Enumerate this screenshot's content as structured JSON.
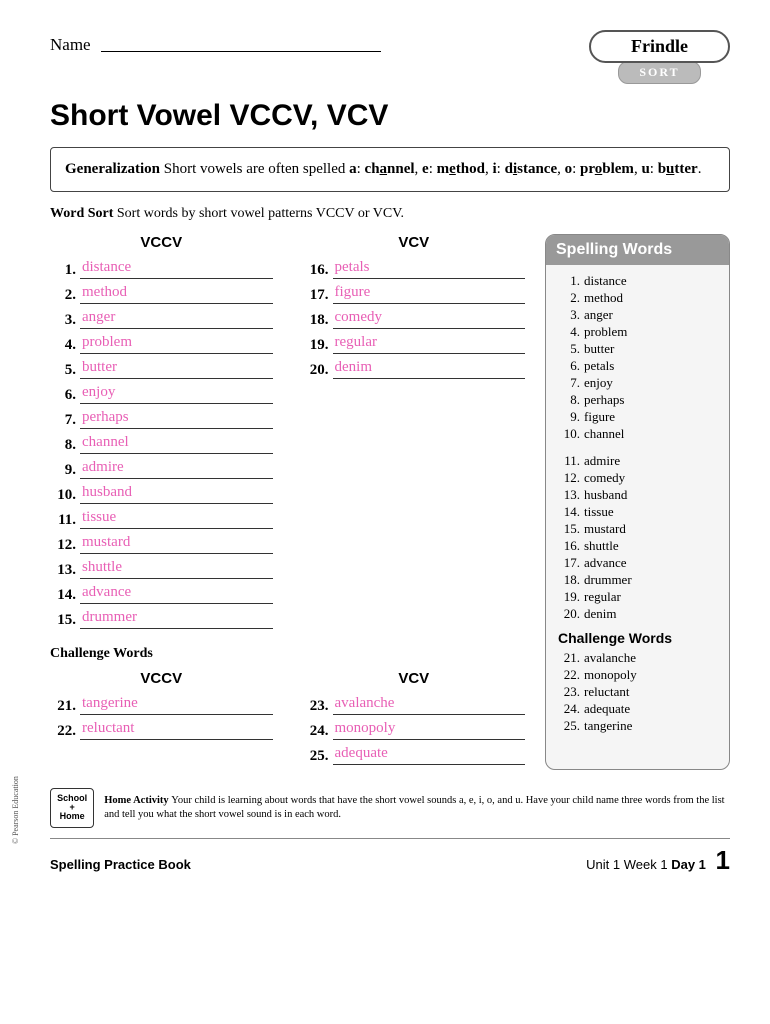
{
  "header": {
    "name_label": "Name",
    "badge_title": "Frindle",
    "badge_action": "SORT"
  },
  "title": "Short Vowel VCCV, VCV",
  "generalization": {
    "label": "Generalization",
    "text_1": "Short vowels are often spelled ",
    "a": "a",
    "aw_pre": "ch",
    "aw_u": "a",
    "aw_post": "nnel",
    "e": "e",
    "ew_pre": "m",
    "ew_u": "e",
    "ew_post": "thod",
    "i": "i",
    "iw_pre": "d",
    "iw_u": "i",
    "iw_post": "stance",
    "o": "o",
    "ow_pre": "pr",
    "ow_u": "o",
    "ow_post": "blem",
    "u": "u",
    "uw_pre": "b",
    "uw_u": "u",
    "uw_post": "tter"
  },
  "instruction": {
    "label": "Word Sort",
    "text": "Sort words by short vowel patterns VCCV or VCV."
  },
  "columns": {
    "vccv_head": "VCCV",
    "vcv_head": "VCV",
    "vccv": [
      {
        "n": "1.",
        "a": "distance"
      },
      {
        "n": "2.",
        "a": "method"
      },
      {
        "n": "3.",
        "a": "anger"
      },
      {
        "n": "4.",
        "a": "problem"
      },
      {
        "n": "5.",
        "a": "butter"
      },
      {
        "n": "6.",
        "a": "enjoy"
      },
      {
        "n": "7.",
        "a": "perhaps"
      },
      {
        "n": "8.",
        "a": "channel"
      },
      {
        "n": "9.",
        "a": "admire"
      },
      {
        "n": "10.",
        "a": "husband"
      },
      {
        "n": "11.",
        "a": "tissue"
      },
      {
        "n": "12.",
        "a": "mustard"
      },
      {
        "n": "13.",
        "a": "shuttle"
      },
      {
        "n": "14.",
        "a": "advance"
      },
      {
        "n": "15.",
        "a": "drummer"
      }
    ],
    "vcv": [
      {
        "n": "16.",
        "a": "petals"
      },
      {
        "n": "17.",
        "a": "figure"
      },
      {
        "n": "18.",
        "a": "comedy"
      },
      {
        "n": "19.",
        "a": "regular"
      },
      {
        "n": "20.",
        "a": "denim"
      }
    ],
    "challenge_label": "Challenge Words",
    "ch_vccv": [
      {
        "n": "21.",
        "a": "tangerine"
      },
      {
        "n": "22.",
        "a": "reluctant"
      }
    ],
    "ch_vcv": [
      {
        "n": "23.",
        "a": "avalanche"
      },
      {
        "n": "24.",
        "a": "monopoly"
      },
      {
        "n": "25.",
        "a": "adequate"
      }
    ]
  },
  "sidebar": {
    "head": "Spelling Words",
    "words": [
      {
        "n": "1.",
        "w": "distance"
      },
      {
        "n": "2.",
        "w": "method"
      },
      {
        "n": "3.",
        "w": "anger"
      },
      {
        "n": "4.",
        "w": "problem"
      },
      {
        "n": "5.",
        "w": "butter"
      },
      {
        "n": "6.",
        "w": "petals"
      },
      {
        "n": "7.",
        "w": "enjoy"
      },
      {
        "n": "8.",
        "w": "perhaps"
      },
      {
        "n": "9.",
        "w": "figure"
      },
      {
        "n": "10.",
        "w": "channel"
      }
    ],
    "words2": [
      {
        "n": "11.",
        "w": "admire"
      },
      {
        "n": "12.",
        "w": "comedy"
      },
      {
        "n": "13.",
        "w": "husband"
      },
      {
        "n": "14.",
        "w": "tissue"
      },
      {
        "n": "15.",
        "w": "mustard"
      },
      {
        "n": "16.",
        "w": "shuttle"
      },
      {
        "n": "17.",
        "w": "advance"
      },
      {
        "n": "18.",
        "w": "drummer"
      },
      {
        "n": "19.",
        "w": "regular"
      },
      {
        "n": "20.",
        "w": "denim"
      }
    ],
    "challenge_head": "Challenge Words",
    "challenge": [
      {
        "n": "21.",
        "w": "avalanche"
      },
      {
        "n": "22.",
        "w": "monopoly"
      },
      {
        "n": "23.",
        "w": "reluctant"
      },
      {
        "n": "24.",
        "w": "adequate"
      },
      {
        "n": "25.",
        "w": "tangerine"
      }
    ]
  },
  "home": {
    "logo_l1": "School",
    "logo_plus": "+",
    "logo_l2": "Home",
    "label": "Home Activity",
    "text": "Your child is learning about words that have the short vowel sounds a, e, i, o, and u. Have your child name three words from the list and tell you what the short vowel sound is in each word."
  },
  "footer": {
    "left": "Spelling Practice Book",
    "unit": "Unit 1  Week 1  ",
    "day": "Day 1",
    "page": "1"
  },
  "copyright": "© Pearson Education"
}
